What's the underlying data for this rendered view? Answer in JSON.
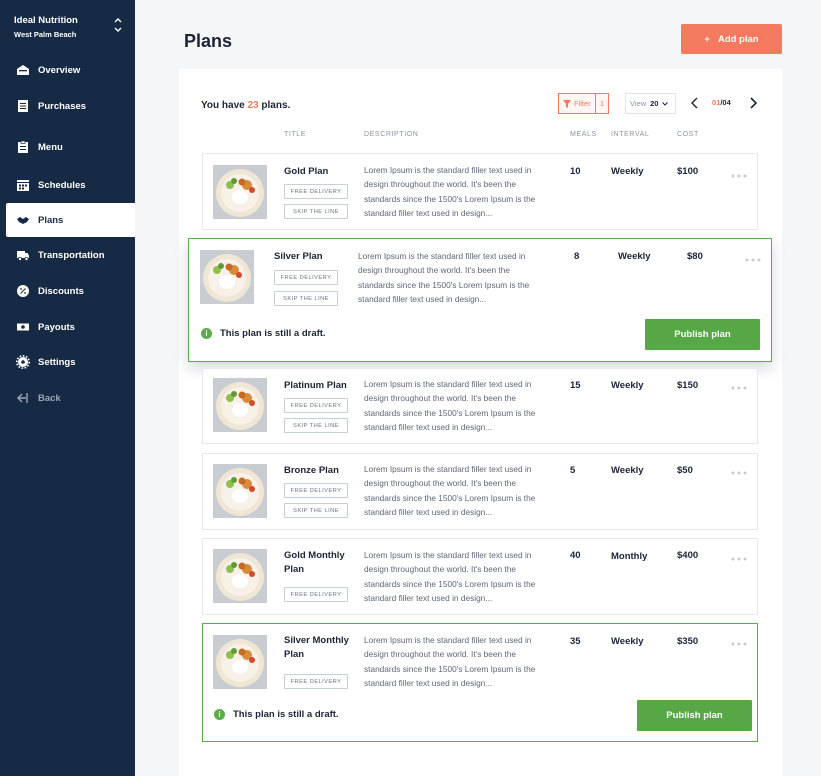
{
  "brand": {
    "name": "Ideal Nutrition",
    "location": "West Palm Beach"
  },
  "nav": [
    {
      "label": "Overview",
      "icon": "overview-icon"
    },
    {
      "label": "Purchases",
      "icon": "receipt-icon"
    },
    {
      "label": "Menu",
      "icon": "clipboard-icon"
    },
    {
      "label": "Schedules",
      "icon": "calendar-icon"
    },
    {
      "label": "Plans",
      "icon": "handshake-icon",
      "active": true
    },
    {
      "label": "Transportation",
      "icon": "truck-icon"
    },
    {
      "label": "Discounts",
      "icon": "discount-icon"
    },
    {
      "label": "Payouts",
      "icon": "money-icon"
    },
    {
      "label": "Settings",
      "icon": "gear-icon"
    },
    {
      "label": "Back",
      "icon": "back-icon"
    }
  ],
  "header": {
    "title": "Plans",
    "add_label": "Add plan",
    "add_symbol": "+"
  },
  "summary": {
    "prefix": "You have",
    "count": "23",
    "suffix": "plans."
  },
  "toolbar": {
    "filter_label": "Filter",
    "filter_count": "1",
    "view_label": "View",
    "view_value": "20",
    "page_current": "01",
    "page_total": "/04"
  },
  "columns": {
    "title": "TITLE",
    "description": "DESCRIPTION",
    "meals": "MEALS",
    "interval": "INTERVAL",
    "cost": "COST"
  },
  "draft_message": "This plan is still a draft.",
  "publish_label": "Publish plan",
  "description_text": "Lorem Ipsum is the standard filler text used in design throughout the world. It's been the standards since the 1500's Lorem Ipsum is the standard filler text used in design...",
  "plans": [
    {
      "title": "Gold Plan",
      "tags": [
        "FREE DELIVERY",
        "SKIP THE LINE"
      ],
      "meals": "10",
      "interval": "Weekly",
      "cost": "$100"
    },
    {
      "title": "Silver Plan",
      "tags": [
        "FREE DELIVERY",
        "SKIP THE LINE"
      ],
      "meals": "8",
      "interval": "Weekly",
      "cost": "$80",
      "draft": true
    },
    {
      "title": "Platinum Plan",
      "tags": [
        "FREE DELIVERY",
        "SKIP THE LINE"
      ],
      "meals": "15",
      "interval": "Weekly",
      "cost": "$150"
    },
    {
      "title": "Bronze Plan",
      "tags": [
        "FREE DELIVERY",
        "SKIP THE LINE"
      ],
      "meals": "5",
      "interval": "Weekly",
      "cost": "$50"
    },
    {
      "title": "Gold Monthly Plan",
      "tags": [
        "FREE DELIVERY"
      ],
      "meals": "40",
      "interval": "Monthly",
      "cost": "$400"
    },
    {
      "title": "Silver Monthly Plan",
      "tags": [
        "FREE DELIVERY"
      ],
      "meals": "35",
      "interval": "Weekly",
      "cost": "$350",
      "draft": true
    }
  ],
  "colors": {
    "sidebar": "#172a45",
    "accent": "#f47a5f",
    "success": "#56a846"
  }
}
